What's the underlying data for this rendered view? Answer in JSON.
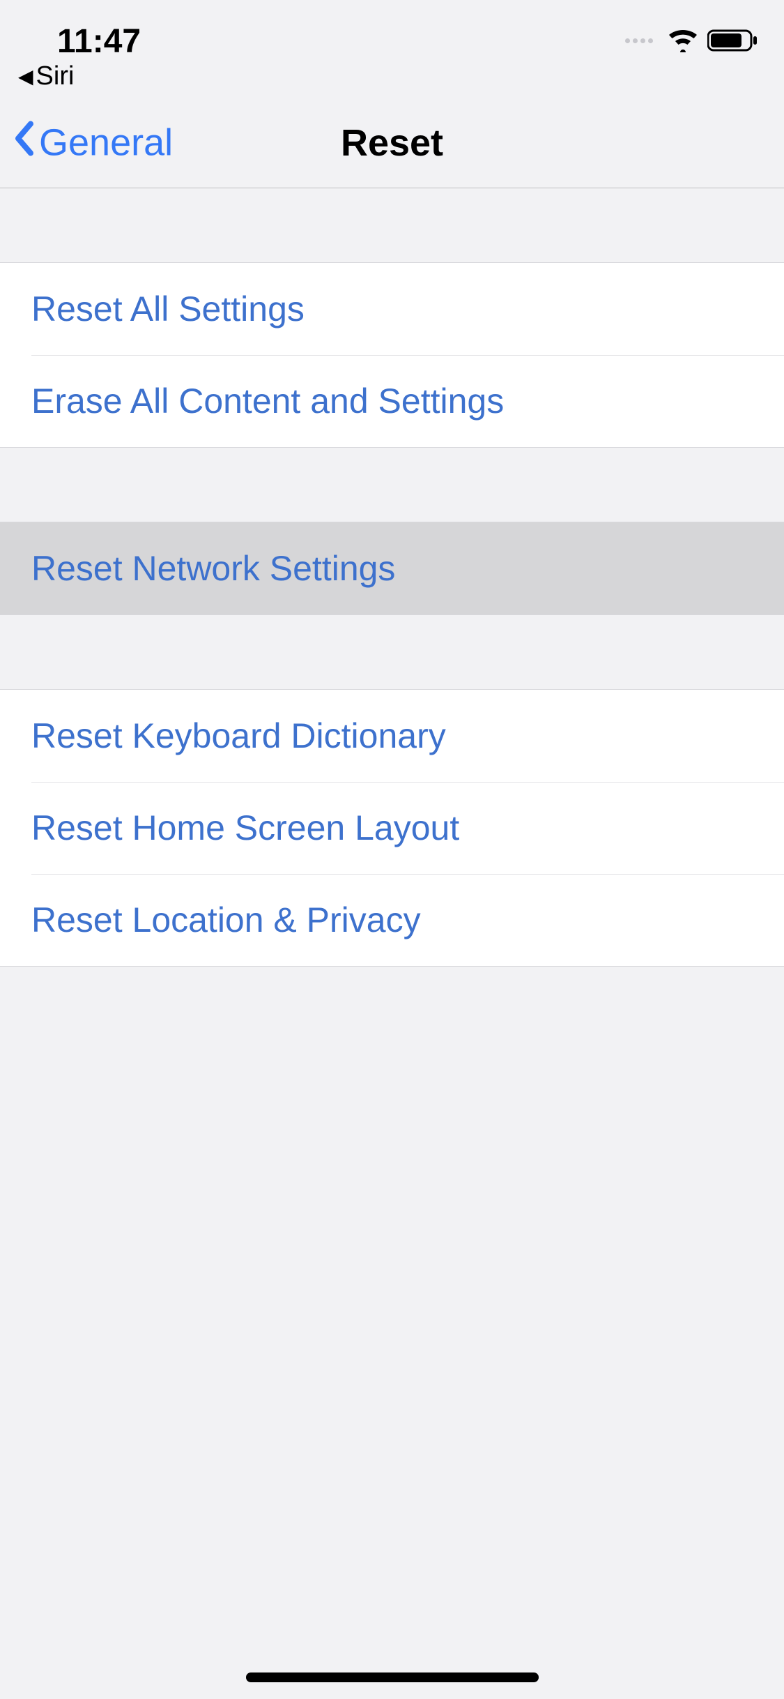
{
  "status": {
    "time": "11:47",
    "breadcrumb_app": "Siri"
  },
  "nav": {
    "back_label": "General",
    "title": "Reset"
  },
  "group1": {
    "row0": "Reset All Settings",
    "row1": "Erase All Content and Settings"
  },
  "group2": {
    "row0": "Reset Network Settings"
  },
  "group3": {
    "row0": "Reset Keyboard Dictionary",
    "row1": "Reset Home Screen Layout",
    "row2": "Reset Location & Privacy"
  }
}
